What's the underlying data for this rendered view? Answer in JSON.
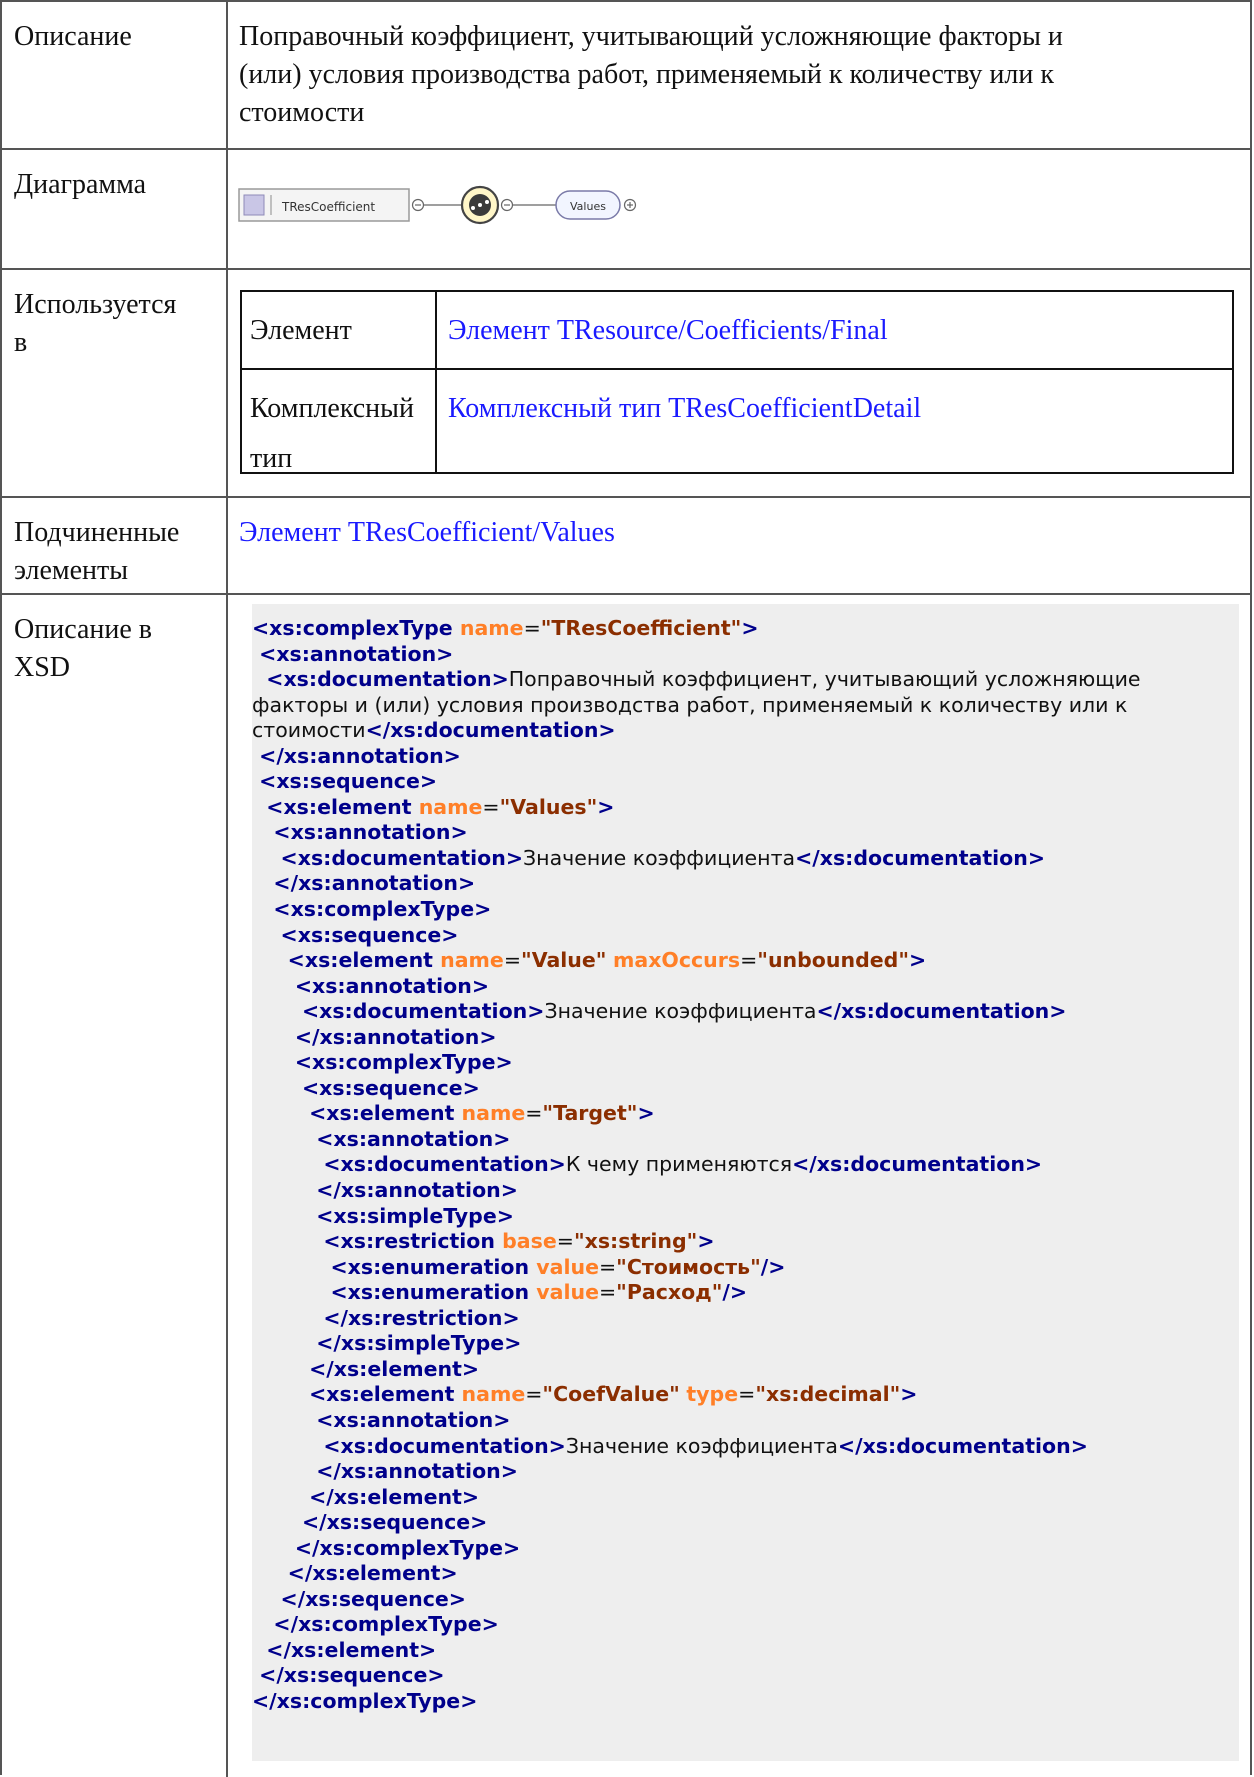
{
  "rows": {
    "description": {
      "label": "Описание",
      "lines": [
        "Поправочный коэффициент, учитывающий усложняющие факторы и",
        "(или) условия производства работ, применяемый к количеству или к",
        "стоимости"
      ]
    },
    "diagram": {
      "label": "Диаграмма",
      "type_name": "TResCoefficient",
      "child_name": "Values"
    },
    "used_in": {
      "label_lines": [
        "Используется",
        "в"
      ],
      "items": [
        {
          "kind_lines": [
            "Элемент"
          ],
          "link": "Элемент TResource/Coefficients/Final"
        },
        {
          "kind_lines": [
            "Комплексный",
            "тип"
          ],
          "link": "Комплексный тип TResCoefficientDetail"
        }
      ]
    },
    "children": {
      "label_lines": [
        "Подчиненные",
        "элементы"
      ],
      "link": "Элемент TResCoefficient/Values"
    },
    "xsd": {
      "label_lines": [
        "Описание в",
        "XSD"
      ],
      "code_lines": [
        [
          [
            "tag",
            "<xs:complexType "
          ],
          [
            "an",
            "name"
          ],
          [
            "eq",
            "="
          ],
          [
            "av",
            "\"TResCoefficient\""
          ],
          [
            "tag",
            ">"
          ]
        ],
        [
          [
            "tag",
            " <xs:annotation>"
          ]
        ],
        [
          [
            "tag",
            "  <xs:documentation>"
          ],
          [
            "txt",
            "Поправочный коэффициент, учитывающий усложняющие"
          ]
        ],
        [
          [
            "txt",
            "факторы и (или) условия производства работ, применяемый к количеству или к"
          ]
        ],
        [
          [
            "txt",
            "стоимости"
          ],
          [
            "tag",
            "</xs:documentation>"
          ]
        ],
        [
          [
            "tag",
            " </xs:annotation>"
          ]
        ],
        [
          [
            "tag",
            " <xs:sequence>"
          ]
        ],
        [
          [
            "tag",
            "  <xs:element "
          ],
          [
            "an",
            "name"
          ],
          [
            "eq",
            "="
          ],
          [
            "av",
            "\"Values\""
          ],
          [
            "tag",
            ">"
          ]
        ],
        [
          [
            "tag",
            "   <xs:annotation>"
          ]
        ],
        [
          [
            "tag",
            "    <xs:documentation>"
          ],
          [
            "txt",
            "Значение коэффициента"
          ],
          [
            "tag",
            "</xs:documentation>"
          ]
        ],
        [
          [
            "tag",
            "   </xs:annotation>"
          ]
        ],
        [
          [
            "tag",
            "   <xs:complexType>"
          ]
        ],
        [
          [
            "tag",
            "    <xs:sequence>"
          ]
        ],
        [
          [
            "tag",
            "     <xs:element "
          ],
          [
            "an",
            "name"
          ],
          [
            "eq",
            "="
          ],
          [
            "av",
            "\"Value\""
          ],
          [
            "eq",
            " "
          ],
          [
            "an",
            "maxOccurs"
          ],
          [
            "eq",
            "="
          ],
          [
            "av",
            "\"unbounded\""
          ],
          [
            "tag",
            ">"
          ]
        ],
        [
          [
            "tag",
            "      <xs:annotation>"
          ]
        ],
        [
          [
            "tag",
            "       <xs:documentation>"
          ],
          [
            "txt",
            "Значение коэффициента"
          ],
          [
            "tag",
            "</xs:documentation>"
          ]
        ],
        [
          [
            "tag",
            "      </xs:annotation>"
          ]
        ],
        [
          [
            "tag",
            "      <xs:complexType>"
          ]
        ],
        [
          [
            "tag",
            "       <xs:sequence>"
          ]
        ],
        [
          [
            "tag",
            "        <xs:element "
          ],
          [
            "an",
            "name"
          ],
          [
            "eq",
            "="
          ],
          [
            "av",
            "\"Target\""
          ],
          [
            "tag",
            ">"
          ]
        ],
        [
          [
            "tag",
            "         <xs:annotation>"
          ]
        ],
        [
          [
            "tag",
            "          <xs:documentation>"
          ],
          [
            "txt",
            "К чему применяются"
          ],
          [
            "tag",
            "</xs:documentation>"
          ]
        ],
        [
          [
            "tag",
            "         </xs:annotation>"
          ]
        ],
        [
          [
            "tag",
            "         <xs:simpleType>"
          ]
        ],
        [
          [
            "tag",
            "          <xs:restriction "
          ],
          [
            "an",
            "base"
          ],
          [
            "eq",
            "="
          ],
          [
            "av",
            "\"xs:string\""
          ],
          [
            "tag",
            ">"
          ]
        ],
        [
          [
            "tag",
            "           <xs:enumeration "
          ],
          [
            "an",
            "value"
          ],
          [
            "eq",
            "="
          ],
          [
            "av",
            "\"Стоимость\""
          ],
          [
            "tag",
            "/>"
          ]
        ],
        [
          [
            "tag",
            "           <xs:enumeration "
          ],
          [
            "an",
            "value"
          ],
          [
            "eq",
            "="
          ],
          [
            "av",
            "\"Расход\""
          ],
          [
            "tag",
            "/>"
          ]
        ],
        [
          [
            "tag",
            "          </xs:restriction>"
          ]
        ],
        [
          [
            "tag",
            "         </xs:simpleType>"
          ]
        ],
        [
          [
            "tag",
            "        </xs:element>"
          ]
        ],
        [
          [
            "tag",
            "        <xs:element "
          ],
          [
            "an",
            "name"
          ],
          [
            "eq",
            "="
          ],
          [
            "av",
            "\"CoefValue\""
          ],
          [
            "eq",
            " "
          ],
          [
            "an",
            "type"
          ],
          [
            "eq",
            "="
          ],
          [
            "av",
            "\"xs:decimal\""
          ],
          [
            "tag",
            ">"
          ]
        ],
        [
          [
            "tag",
            "         <xs:annotation>"
          ]
        ],
        [
          [
            "tag",
            "          <xs:documentation>"
          ],
          [
            "txt",
            "Значение коэффициента"
          ],
          [
            "tag",
            "</xs:documentation>"
          ]
        ],
        [
          [
            "tag",
            "         </xs:annotation>"
          ]
        ],
        [
          [
            "tag",
            "        </xs:element>"
          ]
        ],
        [
          [
            "tag",
            "       </xs:sequence>"
          ]
        ],
        [
          [
            "tag",
            "      </xs:complexType>"
          ]
        ],
        [
          [
            "tag",
            "     </xs:element>"
          ]
        ],
        [
          [
            "tag",
            "    </xs:sequence>"
          ]
        ],
        [
          [
            "tag",
            "   </xs:complexType>"
          ]
        ],
        [
          [
            "tag",
            "  </xs:element>"
          ]
        ],
        [
          [
            "tag",
            " </xs:sequence>"
          ]
        ],
        [
          [
            "tag",
            "</xs:complexType>"
          ]
        ]
      ]
    }
  }
}
